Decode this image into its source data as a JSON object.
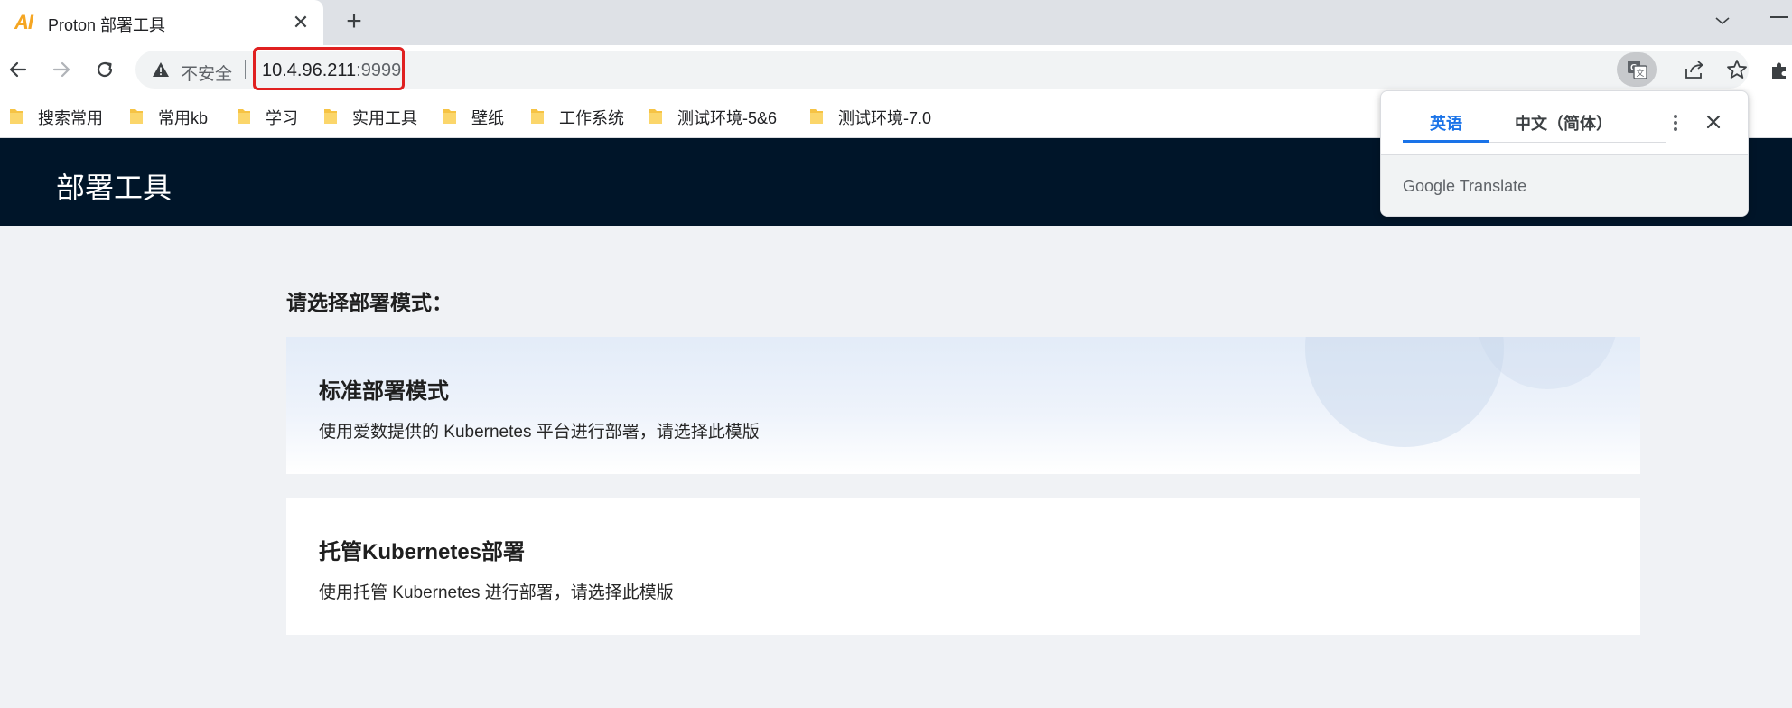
{
  "tab": {
    "logo": "AI",
    "title": "Proton 部署工具",
    "close": "✕",
    "new_tab": "+"
  },
  "toolbar": {
    "security_label": "不安全",
    "url_host": "10.4.96.211",
    "url_port": ":9999"
  },
  "bookmarks": [
    {
      "label": "搜索常用"
    },
    {
      "label": "常用kb"
    },
    {
      "label": "学习"
    },
    {
      "label": "实用工具"
    },
    {
      "label": "壁纸"
    },
    {
      "label": "工作系统"
    },
    {
      "label": "测试环境-5&6"
    },
    {
      "label": "测试环境-7.0"
    }
  ],
  "app": {
    "title": "部署工具"
  },
  "main": {
    "prompt": "请选择部署模式：",
    "cards": [
      {
        "title": "标准部署模式",
        "desc": "使用爱数提供的 Kubernetes 平台进行部署，请选择此模版"
      },
      {
        "title": "托管Kubernetes部署",
        "desc": "使用托管 Kubernetes 进行部署，请选择此模版"
      }
    ]
  },
  "translate_popup": {
    "tab_source": "英语",
    "tab_target": "中文（简体）",
    "brand_google": "Google",
    "brand_translate": "Translate"
  },
  "colors": {
    "header_bg": "#001529",
    "accent": "#1a73e8",
    "url_highlight": "#e02020",
    "logo": "#f5a623"
  }
}
